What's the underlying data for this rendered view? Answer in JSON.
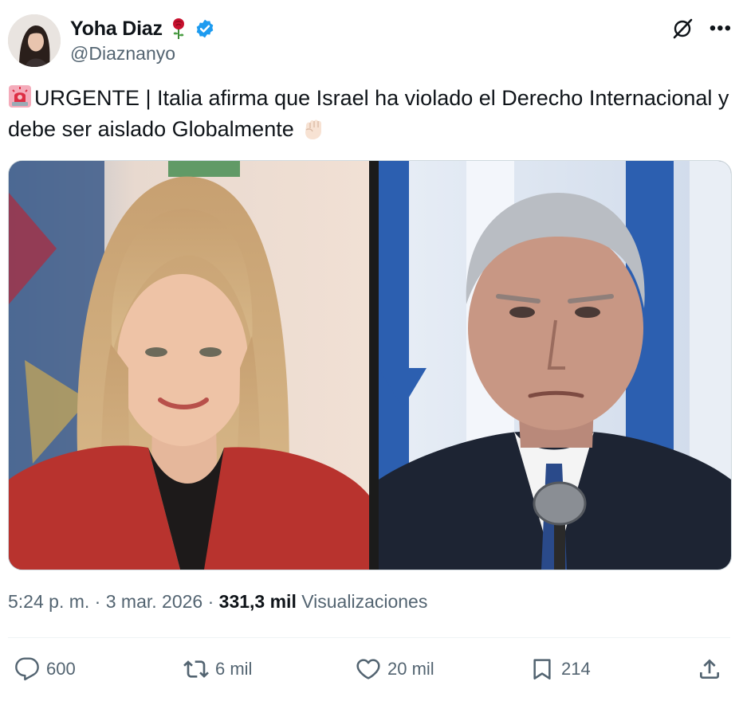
{
  "author": {
    "display_name": "Yoha Diaz",
    "handle": "@Diaznanyo",
    "verified_color": "#1d9bf0",
    "avatar": "avatar-photo"
  },
  "tweet": {
    "text": "URGENTE | Italia afirma que Israel ha violado el Derecho Internacional y debe ser aislado Globalmente",
    "leading_emoji": "siren-emoji",
    "trailing_emoji": "raised-fist-emoji"
  },
  "media": {
    "left_image": "photo-woman-blonde-red-jacket",
    "right_image": "photo-man-suit-microphone-flags"
  },
  "meta": {
    "time": "5:24 p. m.",
    "separator": "·",
    "date": "3 mar. 2026",
    "views_count": "331,3 mil",
    "views_label": "Visualizaciones"
  },
  "actions": {
    "replies": "600",
    "reposts": "6 mil",
    "likes": "20 mil",
    "bookmarks": "214"
  },
  "colors": {
    "text_primary": "#0f1419",
    "text_secondary": "#536471",
    "divider": "#eff3f4"
  }
}
